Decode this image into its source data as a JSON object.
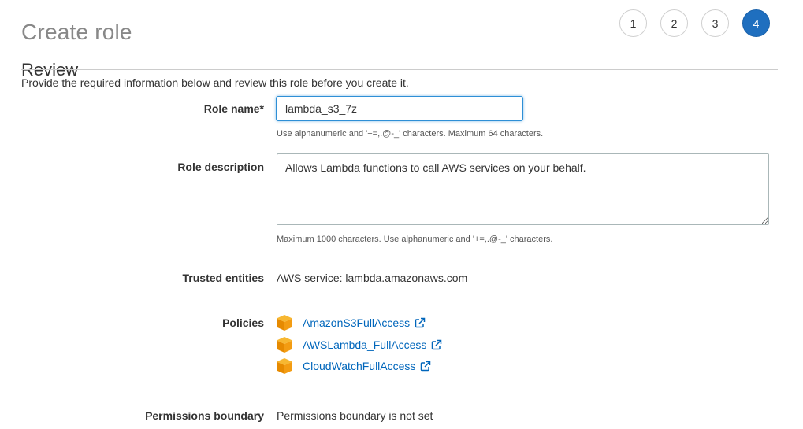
{
  "page": {
    "title": "Create role",
    "steps": [
      "1",
      "2",
      "3",
      "4"
    ],
    "active_step": "4",
    "section_title": "Review",
    "intro": "Provide the required information below and review this role before you create it."
  },
  "form": {
    "role_name": {
      "label": "Role name*",
      "value": "lambda_s3_7z",
      "hint": "Use alphanumeric and '+=,.@-_' characters. Maximum 64 characters."
    },
    "role_description": {
      "label": "Role description",
      "value": "Allows Lambda functions to call AWS services on your behalf.",
      "hint": "Maximum 1000 characters. Use alphanumeric and '+=,.@-_' characters."
    },
    "trusted_entities": {
      "label": "Trusted entities",
      "value": "AWS service: lambda.amazonaws.com"
    },
    "policies": {
      "label": "Policies",
      "items": [
        {
          "name": "AmazonS3FullAccess",
          "icon": "policy-cube-icon"
        },
        {
          "name": "AWSLambda_FullAccess",
          "icon": "policy-cube-icon"
        },
        {
          "name": "CloudWatchFullAccess",
          "icon": "policy-cube-icon"
        }
      ]
    },
    "permissions_boundary": {
      "label": "Permissions boundary",
      "value": "Permissions boundary is not set"
    }
  },
  "colors": {
    "accent": "#1f6fbf",
    "link": "#0066bb",
    "policy_icon": "#f0a30a"
  }
}
